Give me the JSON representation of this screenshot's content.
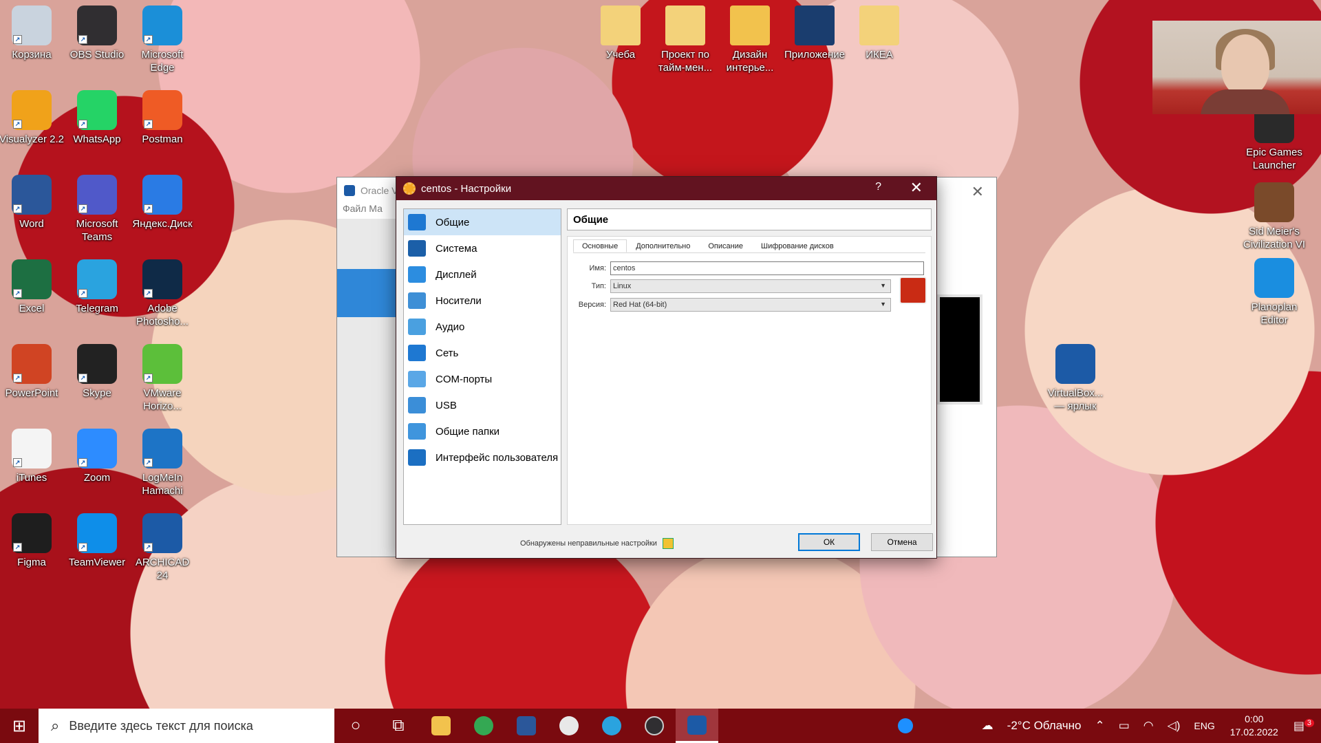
{
  "desktop_icons": [
    {
      "label": "Корзина",
      "icon": "recycle-bin-icon",
      "color": "#c9d3de"
    },
    {
      "label": "OBS Studio",
      "icon": "obs-icon",
      "color": "#302e31"
    },
    {
      "label": "Microsoft Edge",
      "icon": "edge-icon",
      "color": "#1b8fd8"
    },
    {
      "label": "Visualyzer 2.2",
      "icon": "visualyzer-icon",
      "color": "#f0a21a"
    },
    {
      "label": "WhatsApp",
      "icon": "whatsapp-icon",
      "color": "#25d366"
    },
    {
      "label": "Postman",
      "icon": "postman-icon",
      "color": "#ef5b25"
    },
    {
      "label": "Word",
      "icon": "word-icon",
      "color": "#2b579a"
    },
    {
      "label": "Microsoft Teams",
      "icon": "teams-icon",
      "color": "#5059c9"
    },
    {
      "label": "Яндекс.Диск",
      "icon": "yandex-disk-icon",
      "color": "#2a7be4"
    },
    {
      "label": "Excel",
      "icon": "excel-icon",
      "color": "#1d6f42"
    },
    {
      "label": "Telegram",
      "icon": "telegram-icon",
      "color": "#2aa3df"
    },
    {
      "label": "Adobe Photosho...",
      "icon": "photoshop-icon",
      "color": "#0f2a47"
    },
    {
      "label": "PowerPoint",
      "icon": "powerpoint-icon",
      "color": "#d04423"
    },
    {
      "label": "Skype",
      "icon": "skype-icon",
      "color": "#222222"
    },
    {
      "label": "VMware Horizo...",
      "icon": "vmware-horizon-icon",
      "color": "#5cbf3a"
    },
    {
      "label": "iTunes",
      "icon": "itunes-icon",
      "color": "#f4f4f4"
    },
    {
      "label": "Zoom",
      "icon": "zoom-icon",
      "color": "#2d8cff"
    },
    {
      "label": "LogMeIn Hamachi",
      "icon": "hamachi-icon",
      "color": "#1d74c6"
    },
    {
      "label": "Figma",
      "icon": "figma-icon",
      "color": "#1e1e1e"
    },
    {
      "label": "TeamViewer",
      "icon": "teamviewer-icon",
      "color": "#0e8ee9"
    },
    {
      "label": "ARCHICAD 24",
      "icon": "archicad-icon",
      "color": "#1c5aa6"
    }
  ],
  "top_icons": [
    {
      "label": "Учеба",
      "icon": "folder-icon",
      "color": "#f3d27a"
    },
    {
      "label": "Проект по тайм-мен...",
      "icon": "word-document-icon",
      "color": "#f3d27a"
    },
    {
      "label": "Дизайн интерье...",
      "icon": "folder-icon",
      "color": "#f2c24d"
    },
    {
      "label": "Приложение",
      "icon": "book-icon",
      "color": "#1a3d6e"
    },
    {
      "label": "ИКЕА",
      "icon": "ikea-file-icon",
      "color": "#f3d27a"
    }
  ],
  "right_icons": [
    {
      "label": "Epic Games Launcher",
      "icon": "epic-games-icon",
      "color": "#2a2a2a"
    },
    {
      "label": "Sid Meier's Civilization VI",
      "icon": "civilization-icon",
      "color": "#7a4a2a"
    },
    {
      "label": "Planoplan Editor",
      "icon": "planoplan-icon",
      "color": "#1a8ee0"
    },
    {
      "label": "VirtualBox... — ярлык",
      "icon": "virtualbox-icon",
      "color": "#1c5aa6"
    }
  ],
  "background_window": {
    "title": "Oracle V",
    "menu": "Файл   Ма"
  },
  "dialog": {
    "title": "centos - Настройки",
    "help": "?",
    "close": "✕",
    "header": "Общие",
    "nav": [
      {
        "label": "Общие",
        "icon": "general-icon",
        "color": "#1e78d2",
        "active": true
      },
      {
        "label": "Система",
        "icon": "system-icon",
        "color": "#1b5fa8"
      },
      {
        "label": "Дисплей",
        "icon": "display-icon",
        "color": "#2c8de0"
      },
      {
        "label": "Носители",
        "icon": "storage-icon",
        "color": "#3e8fd6"
      },
      {
        "label": "Аудио",
        "icon": "audio-icon",
        "color": "#4aa0e0"
      },
      {
        "label": "Сеть",
        "icon": "network-icon",
        "color": "#1e78d2"
      },
      {
        "label": "COM-порты",
        "icon": "serial-ports-icon",
        "color": "#5aa7e6"
      },
      {
        "label": "USB",
        "icon": "usb-icon",
        "color": "#3b8ed8"
      },
      {
        "label": "Общие папки",
        "icon": "shared-folders-icon",
        "color": "#3f95dd"
      },
      {
        "label": "Интерфейс пользователя",
        "icon": "user-interface-icon",
        "color": "#1b6fc2"
      }
    ],
    "tabs": [
      "Основные",
      "Дополнительно",
      "Описание",
      "Шифрование дисков"
    ],
    "fields": {
      "name_label": "Имя:",
      "name_value": "centos",
      "type_label": "Тип:",
      "type_value": "Linux",
      "version_label": "Версия:",
      "version_value": "Red Hat (64-bit)"
    },
    "warning": "Обнаружены неправильные настройки",
    "ok": "ОК",
    "cancel": "Отмена"
  },
  "taskbar": {
    "search_placeholder": "Введите здесь текст для поиска",
    "weather": "-2°C  Облачно",
    "lang": "ENG",
    "time": "0:00",
    "date": "17.02.2022",
    "notifications": "3",
    "accent": "#7a0a0f"
  }
}
